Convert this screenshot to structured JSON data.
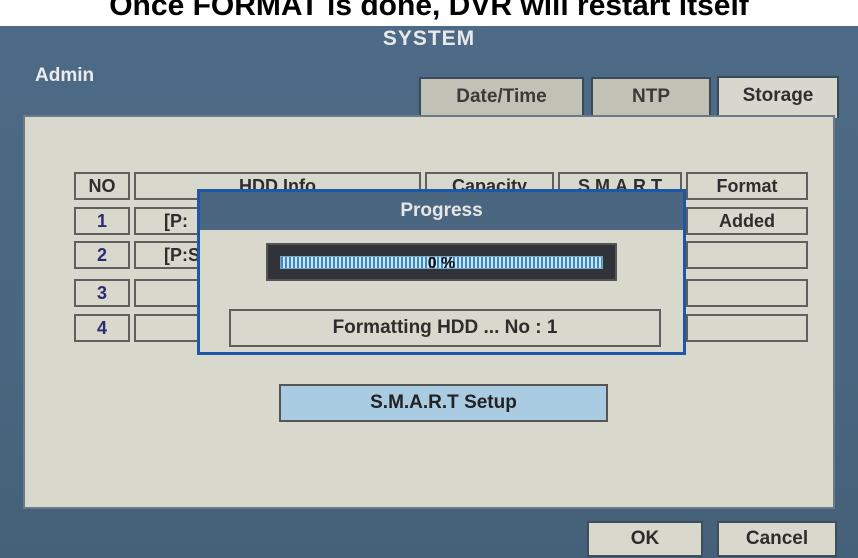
{
  "caption": "Once FORMAT is done, DVR will restart itself",
  "window": {
    "title": "SYSTEM",
    "user": "Admin"
  },
  "tabs": [
    {
      "label": "Date/Time",
      "active": false
    },
    {
      "label": "NTP",
      "active": false
    },
    {
      "label": "Storage",
      "active": true
    }
  ],
  "table": {
    "headers": [
      "NO",
      "HDD Info",
      "Capacity",
      "S.M.A.R.T",
      "Format"
    ],
    "rows": [
      {
        "no": "1",
        "info": "[P:",
        "capacity": "",
        "smart": "",
        "format": "Added"
      },
      {
        "no": "2",
        "info": "[P:S",
        "capacity": "",
        "smart": "",
        "format": ""
      },
      {
        "no": "3",
        "info": "",
        "capacity": "",
        "smart": "",
        "format": ""
      },
      {
        "no": "4",
        "info": "",
        "capacity": "",
        "smart": "",
        "format": ""
      }
    ]
  },
  "smart_setup_label": "S.M.A.R.T Setup",
  "dialog": {
    "title": "Progress",
    "progress_text": "0 %",
    "progress_fraction": 0,
    "status_text": "Formatting HDD ... No : 1"
  },
  "footer": {
    "ok_label": "OK",
    "cancel_label": "Cancel"
  },
  "colors": {
    "screen_bg": "#4a6680",
    "panel_bg": "#d9d8cc",
    "button_accent": "#a9cce3",
    "dialog_border": "#1f57a8",
    "progress_fill": "#3d88c4"
  }
}
